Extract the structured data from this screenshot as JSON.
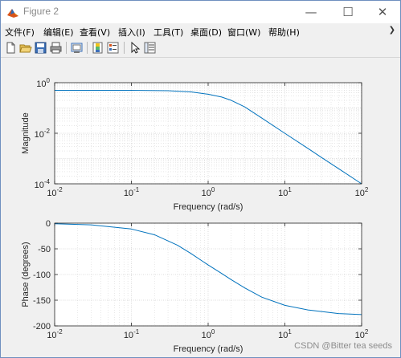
{
  "window": {
    "title": "Figure 2",
    "controls": {
      "minimize": "—",
      "maximize": "☐",
      "close": "✕"
    }
  },
  "menu": {
    "items": [
      "文件(F)",
      "编辑(E)",
      "查看(V)",
      "插入(I)",
      "工具(T)",
      "桌面(D)",
      "窗口(W)",
      "帮助(H)"
    ],
    "overflow_icon": "chevron-right-icon"
  },
  "toolbar": {
    "buttons": [
      "new-figure-icon",
      "open-file-icon",
      "save-icon",
      "print-icon",
      "link-plot-icon",
      "insert-colorbar-icon",
      "insert-legend-icon",
      "edit-plot-icon",
      "property-inspector-icon"
    ]
  },
  "colors": {
    "line": "#0072bd",
    "grid": "#d9d9d9",
    "axes": "#262626"
  },
  "chart_data": [
    {
      "type": "line",
      "x_scale": "log",
      "y_scale": "log",
      "xlabel": "Frequency (rad/s)",
      "ylabel": "Magnitude",
      "xlim": [
        0.01,
        100
      ],
      "ylim": [
        0.0001,
        1
      ],
      "x_ticks": [
        {
          "value": 0.01,
          "base": "10",
          "exp": "-2"
        },
        {
          "value": 0.1,
          "base": "10",
          "exp": "-1"
        },
        {
          "value": 1,
          "base": "10",
          "exp": "0"
        },
        {
          "value": 10,
          "base": "10",
          "exp": "1"
        },
        {
          "value": 100,
          "base": "10",
          "exp": "2"
        }
      ],
      "y_ticks": [
        {
          "value": 0.0001,
          "base": "10",
          "exp": "-4"
        },
        {
          "value": 0.01,
          "base": "10",
          "exp": "-2"
        },
        {
          "value": 1,
          "base": "10",
          "exp": "0"
        }
      ],
      "grid": true,
      "x": [
        0.01,
        0.03,
        0.1,
        0.3,
        0.6,
        1,
        1.5,
        2,
        3,
        5,
        10,
        20,
        30,
        50,
        100
      ],
      "y": [
        0.5,
        0.5,
        0.5,
        0.48,
        0.43,
        0.35,
        0.27,
        0.2,
        0.11,
        0.04,
        0.0099,
        0.0025,
        0.0011,
        0.0004,
        0.0001
      ]
    },
    {
      "type": "line",
      "x_scale": "log",
      "xlabel": "Frequency (rad/s)",
      "ylabel": "Phase (degrees)",
      "xlim": [
        0.01,
        100
      ],
      "ylim": [
        -200,
        0
      ],
      "x_ticks": [
        {
          "value": 0.01,
          "base": "10",
          "exp": "-2"
        },
        {
          "value": 0.1,
          "base": "10",
          "exp": "-1"
        },
        {
          "value": 1,
          "base": "10",
          "exp": "0"
        },
        {
          "value": 10,
          "base": "10",
          "exp": "1"
        },
        {
          "value": 100,
          "base": "10",
          "exp": "2"
        }
      ],
      "y_ticks": [
        {
          "value": 0,
          "label": "0"
        },
        {
          "value": -50,
          "label": "-50"
        },
        {
          "value": -100,
          "label": "-100"
        },
        {
          "value": -150,
          "label": "-150"
        },
        {
          "value": -200,
          "label": "-200"
        }
      ],
      "grid": true,
      "x": [
        0.01,
        0.03,
        0.1,
        0.2,
        0.4,
        0.6,
        1,
        1.5,
        2,
        3,
        5,
        10,
        20,
        50,
        100
      ],
      "y": [
        -1.1,
        -3.4,
        -11.4,
        -22.6,
        -43,
        -59.3,
        -81.4,
        -98,
        -110,
        -126,
        -144,
        -160,
        -169,
        -176,
        -178
      ]
    }
  ],
  "watermark": "CSDN @Bitter tea seeds"
}
